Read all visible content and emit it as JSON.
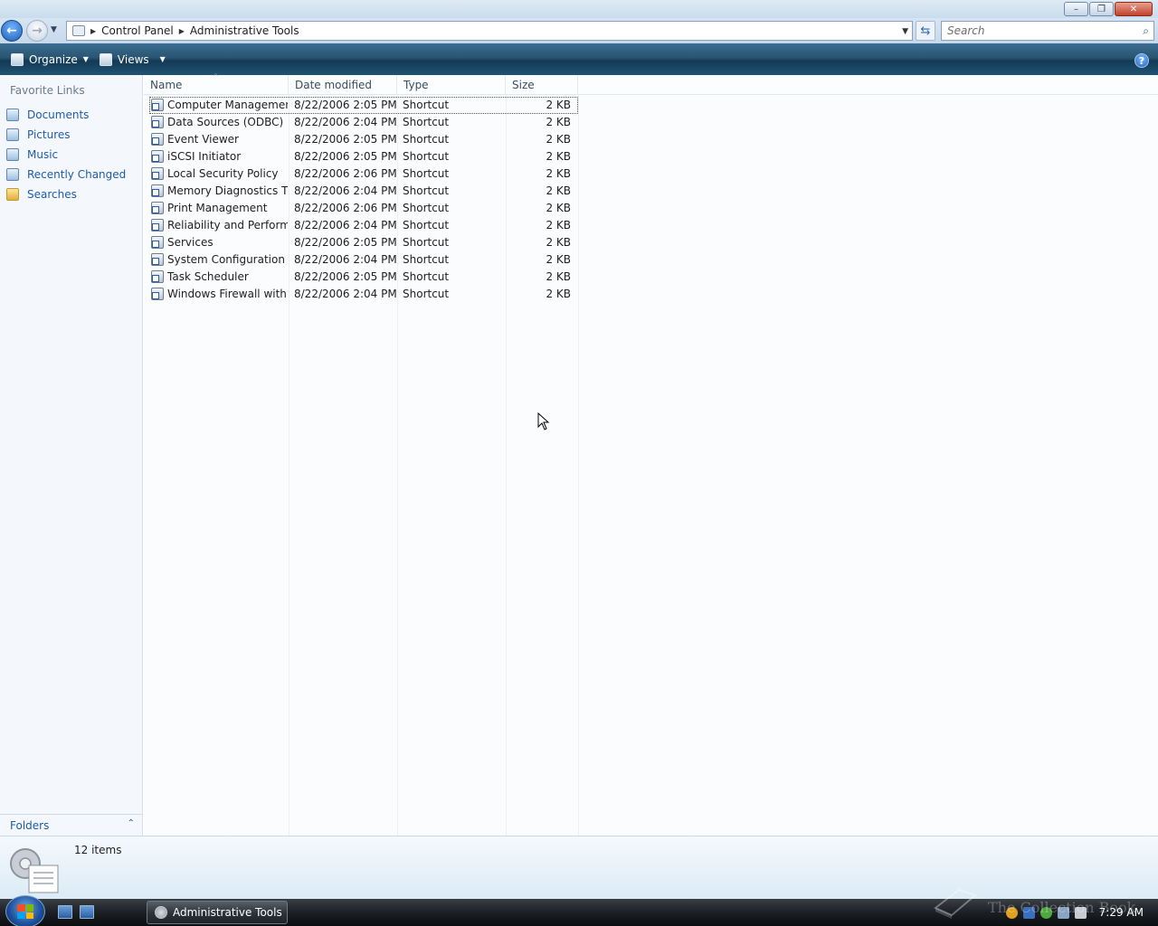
{
  "window": {
    "controls": {
      "minimize": "–",
      "maximize": "❐",
      "close": "✕"
    }
  },
  "address": {
    "crumbs": [
      "Control Panel",
      "Administrative Tools"
    ],
    "search_placeholder": "Search"
  },
  "commandbar": {
    "organize_label": "Organize",
    "views_label": "Views"
  },
  "navpane": {
    "heading": "Favorite Links",
    "links": [
      {
        "label": "Documents",
        "icon": "documents-icon"
      },
      {
        "label": "Pictures",
        "icon": "pictures-icon"
      },
      {
        "label": "Music",
        "icon": "music-icon"
      },
      {
        "label": "Recently Changed",
        "icon": "recently-changed-icon"
      },
      {
        "label": "Searches",
        "icon": "searches-folder-icon"
      }
    ],
    "folders_label": "Folders"
  },
  "filelist": {
    "columns": [
      "Name",
      "Date modified",
      "Type",
      "Size"
    ],
    "rows": [
      {
        "name": "Computer Management",
        "date": "8/22/2006 2:05 PM",
        "type": "Shortcut",
        "size": "2 KB",
        "selected": true
      },
      {
        "name": "Data Sources (ODBC)",
        "date": "8/22/2006 2:04 PM",
        "type": "Shortcut",
        "size": "2 KB"
      },
      {
        "name": "Event Viewer",
        "date": "8/22/2006 2:05 PM",
        "type": "Shortcut",
        "size": "2 KB"
      },
      {
        "name": "iSCSI Initiator",
        "date": "8/22/2006 2:05 PM",
        "type": "Shortcut",
        "size": "2 KB"
      },
      {
        "name": "Local Security Policy",
        "date": "8/22/2006 2:06 PM",
        "type": "Shortcut",
        "size": "2 KB"
      },
      {
        "name": "Memory Diagnostics T...",
        "date": "8/22/2006 2:04 PM",
        "type": "Shortcut",
        "size": "2 KB"
      },
      {
        "name": "Print Management",
        "date": "8/22/2006 2:06 PM",
        "type": "Shortcut",
        "size": "2 KB"
      },
      {
        "name": "Reliability and Perform...",
        "date": "8/22/2006 2:04 PM",
        "type": "Shortcut",
        "size": "2 KB"
      },
      {
        "name": "Services",
        "date": "8/22/2006 2:05 PM",
        "type": "Shortcut",
        "size": "2 KB"
      },
      {
        "name": "System Configuration",
        "date": "8/22/2006 2:04 PM",
        "type": "Shortcut",
        "size": "2 KB"
      },
      {
        "name": "Task Scheduler",
        "date": "8/22/2006 2:05 PM",
        "type": "Shortcut",
        "size": "2 KB"
      },
      {
        "name": "Windows Firewall with ...",
        "date": "8/22/2006 2:04 PM",
        "type": "Shortcut",
        "size": "2 KB"
      }
    ]
  },
  "details": {
    "item_count": "12 items"
  },
  "taskbar": {
    "active_window": "Administrative Tools",
    "clock": "7:29 AM",
    "watermark": "The Collection Book"
  },
  "colors": {
    "link": "#1f5cab",
    "commandbar": "#285572",
    "taskbar": "#1c1f24"
  }
}
